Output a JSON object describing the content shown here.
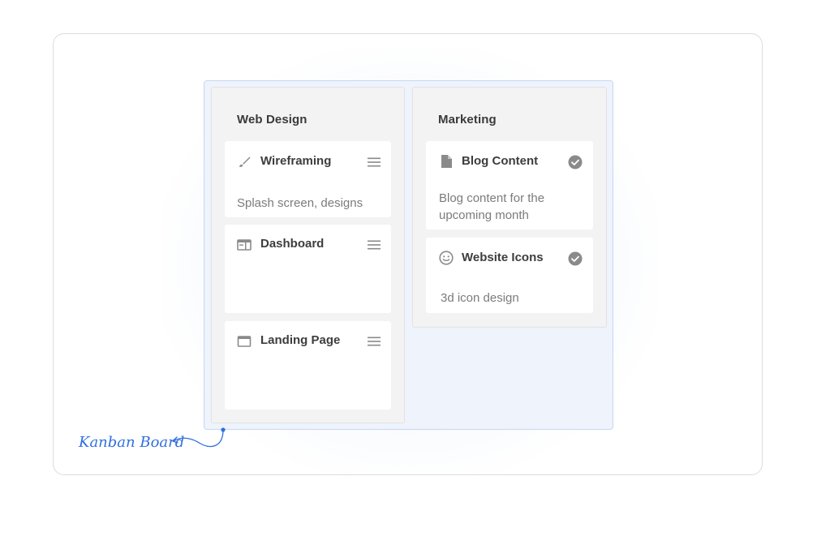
{
  "annotation": {
    "label": "Kanban Board"
  },
  "colors": {
    "accent": "#2f6fe0",
    "board_border": "#c8d7f5",
    "column_bg": "#f3f3f3",
    "icon_gray": "#8a8a8a"
  },
  "columns": [
    {
      "title": "Web Design",
      "cards": [
        {
          "title": "Wireframing",
          "description": "Splash screen, designs",
          "icon": "brush-icon",
          "action_icon": "drag-handle-icon"
        },
        {
          "title": "Dashboard",
          "description": "",
          "icon": "dashboard-window-icon",
          "action_icon": "drag-handle-icon"
        },
        {
          "title": "Landing Page",
          "description": "",
          "icon": "browser-window-icon",
          "action_icon": "drag-handle-icon"
        }
      ]
    },
    {
      "title": "Marketing",
      "cards": [
        {
          "title": "Blog Content",
          "description": "Blog content for the upcoming month",
          "icon": "document-icon",
          "action_icon": "check-circle-icon"
        },
        {
          "title": "Website Icons",
          "description": "3d icon design",
          "icon": "smiley-icon",
          "action_icon": "check-circle-icon"
        }
      ]
    }
  ]
}
